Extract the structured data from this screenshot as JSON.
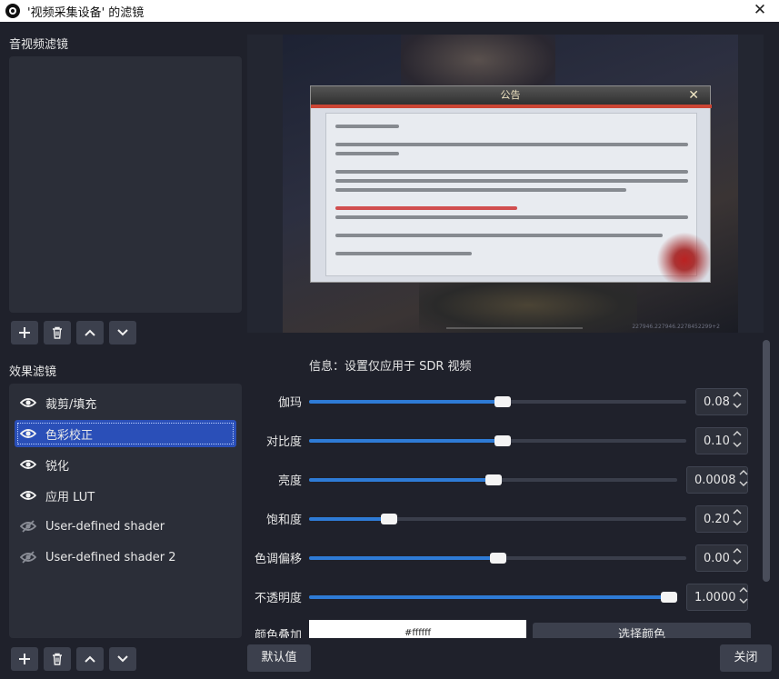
{
  "window": {
    "title": "'视频采集设备' 的滤镜"
  },
  "audio_filters": {
    "title": "音视频滤镜",
    "items": []
  },
  "effect_filters": {
    "title": "效果滤镜",
    "items": [
      {
        "label": "裁剪/填充",
        "enabled": true,
        "selected": false
      },
      {
        "label": "色彩校正",
        "enabled": true,
        "selected": true
      },
      {
        "label": "锐化",
        "enabled": true,
        "selected": false
      },
      {
        "label": "应用 LUT",
        "enabled": true,
        "selected": false
      },
      {
        "label": "User-defined shader",
        "enabled": false,
        "selected": false
      },
      {
        "label": "User-defined shader 2",
        "enabled": false,
        "selected": false
      }
    ]
  },
  "toolbar_icons": [
    "plus-icon",
    "trash-icon",
    "chevron-up-icon",
    "chevron-down-icon"
  ],
  "preview": {
    "notice_title": "公告",
    "watermark": "227946.227946.2278452299+2"
  },
  "properties": {
    "info": "信息：设置仅应用于 SDR 视频",
    "rows": [
      {
        "label": "伽玛",
        "value": "0.08",
        "fraction": 0.513
      },
      {
        "label": "对比度",
        "value": "0.10",
        "fraction": 0.513
      },
      {
        "label": "亮度",
        "value": "0.0008",
        "fraction": 0.5
      },
      {
        "label": "饱和度",
        "value": "0.20",
        "fraction": 0.213
      },
      {
        "label": "色调偏移",
        "value": "0.00",
        "fraction": 0.5
      },
      {
        "label": "不透明度",
        "value": "1.0000",
        "fraction": 1.0
      }
    ],
    "color_label": "颜色叠加",
    "color_value": "#ffffff",
    "choose_color": "选择颜色"
  },
  "footer": {
    "defaults": "默认值",
    "close": "关闭"
  },
  "colors": {
    "accent": "#2e7bd6",
    "selected": "#2a4fb8",
    "background": "#1f212b"
  }
}
